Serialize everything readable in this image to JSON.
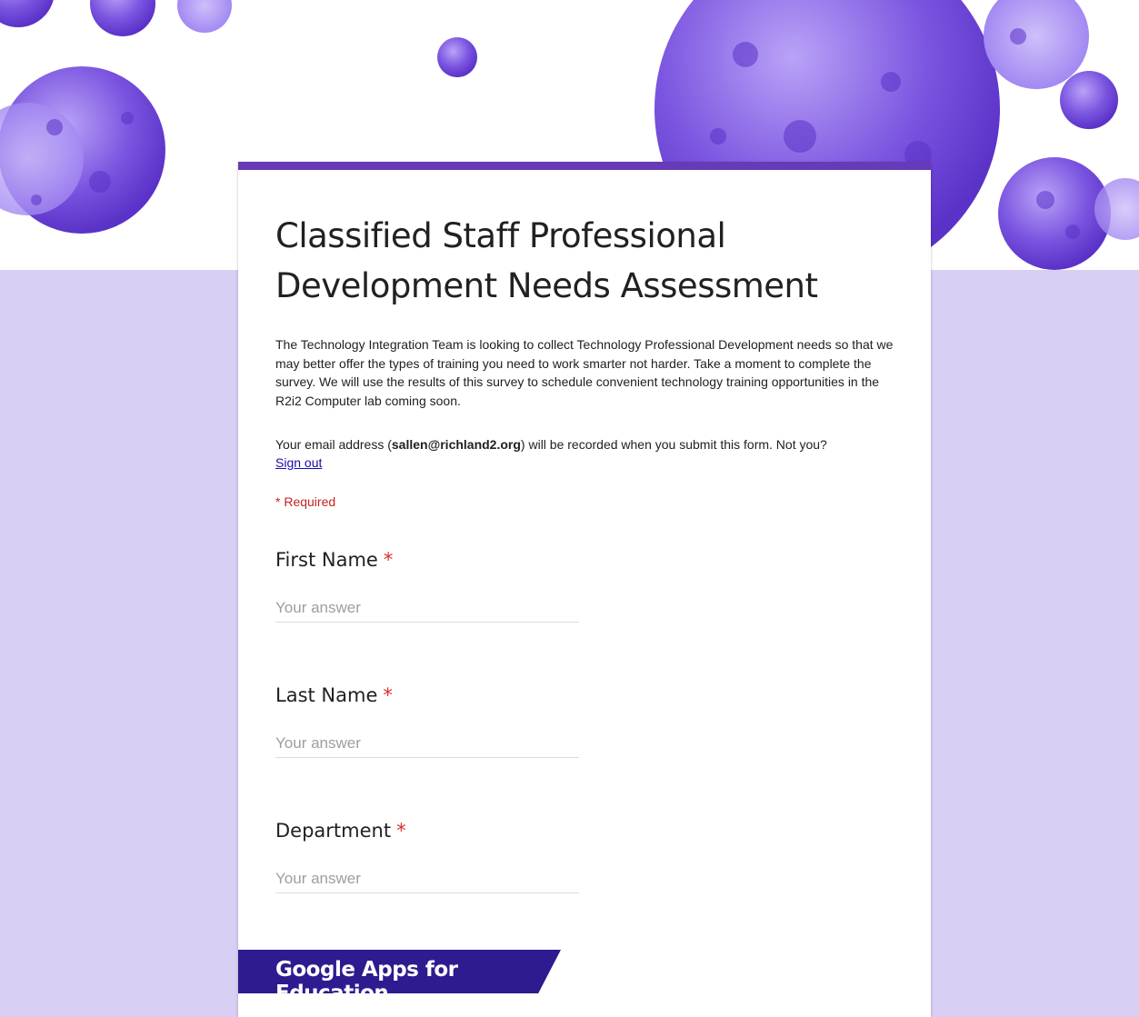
{
  "form": {
    "title": "Classified Staff Professional Development Needs Assessment",
    "description": "The Technology Integration Team is looking to collect Technology Professional Development needs so that we may better offer the types of training you need to work smarter not harder.  Take a moment to complete the survey.  We will use the results of this survey to schedule convenient technology training opportunities in the R2i2 Computer lab coming soon.",
    "email_prefix": "Your email address (",
    "email_address": "sallen@richland2.org",
    "email_suffix": ") will be recorded when you submit this form. Not you?",
    "sign_out": "Sign out",
    "required_note": "* Required",
    "required_star": "*",
    "questions": [
      {
        "label": "First Name",
        "placeholder": "Your answer"
      },
      {
        "label": "Last Name",
        "placeholder": "Your answer"
      },
      {
        "label": "Department",
        "placeholder": "Your answer"
      }
    ],
    "footer_badge": "Google Apps for Education"
  },
  "colors": {
    "accent": "#673ab7",
    "background": "#d9cff5",
    "banner_bubbles": "#7b55e0",
    "badge": "#2d1b8f",
    "required": "#d93025"
  }
}
